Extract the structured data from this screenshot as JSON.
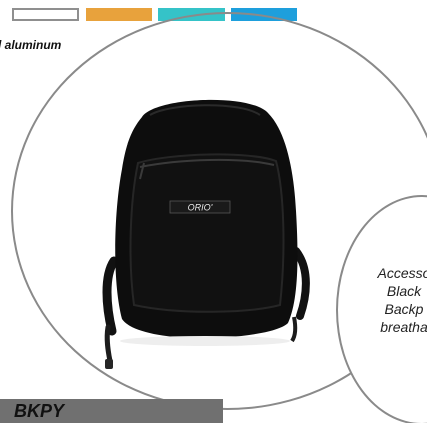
{
  "swatches": [
    {
      "name": "white",
      "color": "#ffffff"
    },
    {
      "name": "orange",
      "color": "#e8a23c"
    },
    {
      "name": "teal",
      "color": "#35c3c8"
    },
    {
      "name": "blue",
      "color": "#1e9fdc"
    }
  ],
  "material_label": "l aluminum",
  "product": {
    "brand_logo": "ORIO'",
    "sku": "BKPY"
  },
  "detail_text": {
    "line1": "Accesso",
    "line2": "Black",
    "line3": "Backp",
    "line4": "breatha"
  },
  "colors": {
    "circle_border": "#8a8a8a",
    "bag": "#0d0d0d",
    "sku_bar": "#707070"
  }
}
